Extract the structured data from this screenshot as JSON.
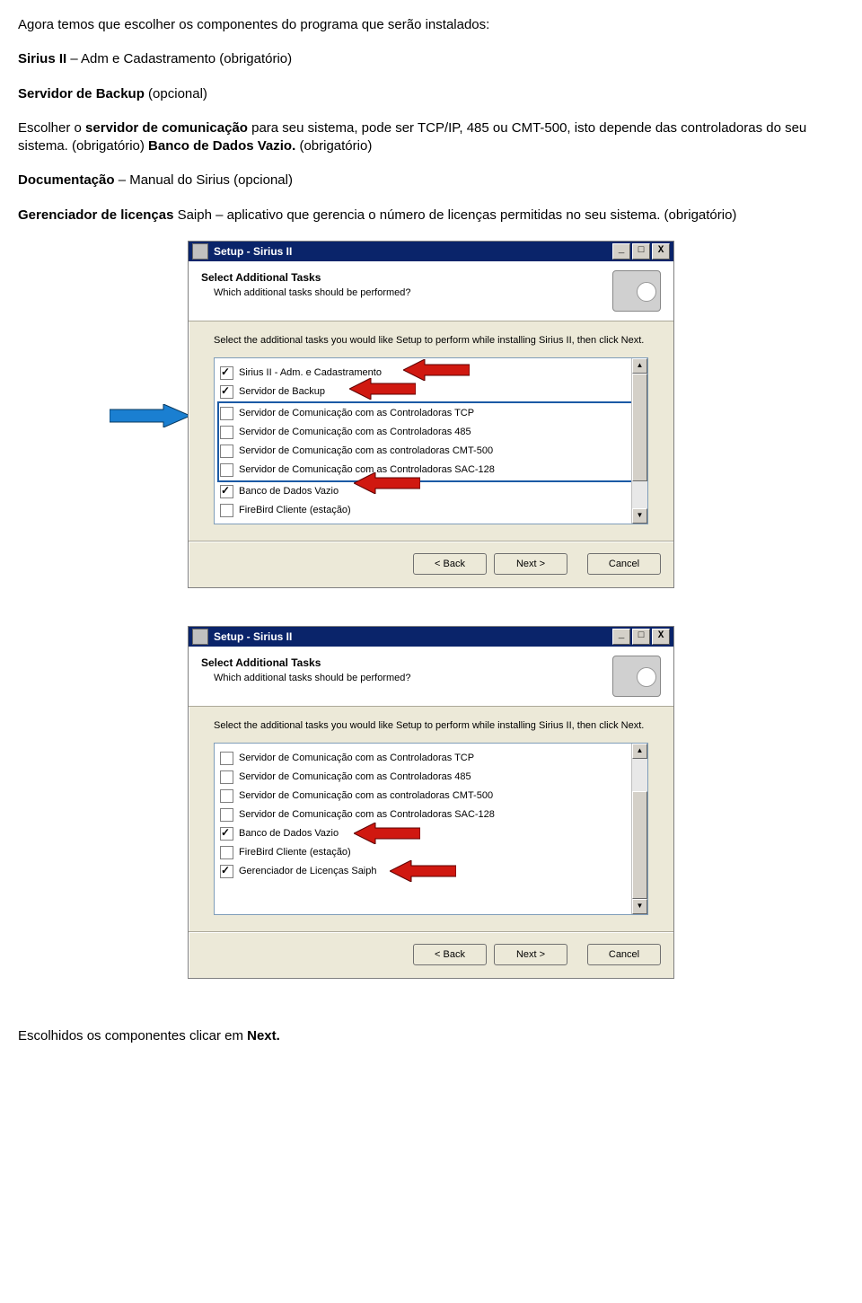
{
  "doc": {
    "p1": "Agora temos que escolher os componentes do programa que serão instalados:",
    "p2_b": "Sirius II",
    "p2_rest": " – Adm e Cadastramento (obrigatório)",
    "p3_b": "Servidor de Backup",
    "p3_rest": " (opcional)",
    "p4_a": "Escolher o ",
    "p4_b": "servidor de comunicação",
    "p4_c": " para seu sistema, pode ser TCP/IP, 485 ou CMT-500, isto depende das controladoras do seu sistema. (obrigatório)",
    "p4_d": " Banco de Dados Vazio.",
    "p4_e": " (obrigatório)",
    "p5_b": "Documentação",
    "p5_rest": " – Manual do Sirius (opcional)",
    "p6_b": "Gerenciador de licenças",
    "p6_rest": " Saiph – aplicativo que gerencia o número de licenças permitidas no seu sistema. (obrigatório)",
    "p_end_a": "Escolhidos os componentes clicar em ",
    "p_end_b": "Next."
  },
  "dialog": {
    "title": "Setup - Sirius II",
    "min": "_",
    "max": "□",
    "close": "X",
    "heading": "Select Additional Tasks",
    "sub": "Which additional tasks should be performed?",
    "body_msg": "Select the additional tasks you would like Setup to perform while installing Sirius II, then click Next.",
    "back": "< Back",
    "next": "Next >",
    "cancel": "Cancel",
    "scroll_up": "▲",
    "scroll_down": "▼"
  },
  "tasks1": [
    {
      "checked": true,
      "label": "Sirius II - Adm. e Cadastramento"
    },
    {
      "checked": true,
      "label": "Servidor de Backup"
    },
    {
      "checked": false,
      "label": "Servidor de Comunicação com as Controladoras TCP"
    },
    {
      "checked": false,
      "label": "Servidor de Comunicação com as Controladoras 485"
    },
    {
      "checked": false,
      "label": "Servidor de Comunicação com as controladoras CMT-500"
    },
    {
      "checked": false,
      "label": "Servidor de Comunicação com as Controladoras SAC-128"
    },
    {
      "checked": true,
      "label": "Banco de Dados Vazio"
    },
    {
      "checked": false,
      "label": "FireBird Cliente (estação)"
    }
  ],
  "tasks2": [
    {
      "checked": false,
      "label": "Servidor de Comunicação com as Controladoras TCP"
    },
    {
      "checked": false,
      "label": "Servidor de Comunicação com as Controladoras 485"
    },
    {
      "checked": false,
      "label": "Servidor de Comunicação com as controladoras CMT-500"
    },
    {
      "checked": false,
      "label": "Servidor de Comunicação com as Controladoras SAC-128"
    },
    {
      "checked": true,
      "label": "Banco de Dados Vazio"
    },
    {
      "checked": false,
      "label": "FireBird Cliente (estação)"
    },
    {
      "checked": true,
      "label": "Gerenciador de Licenças Saiph"
    }
  ]
}
